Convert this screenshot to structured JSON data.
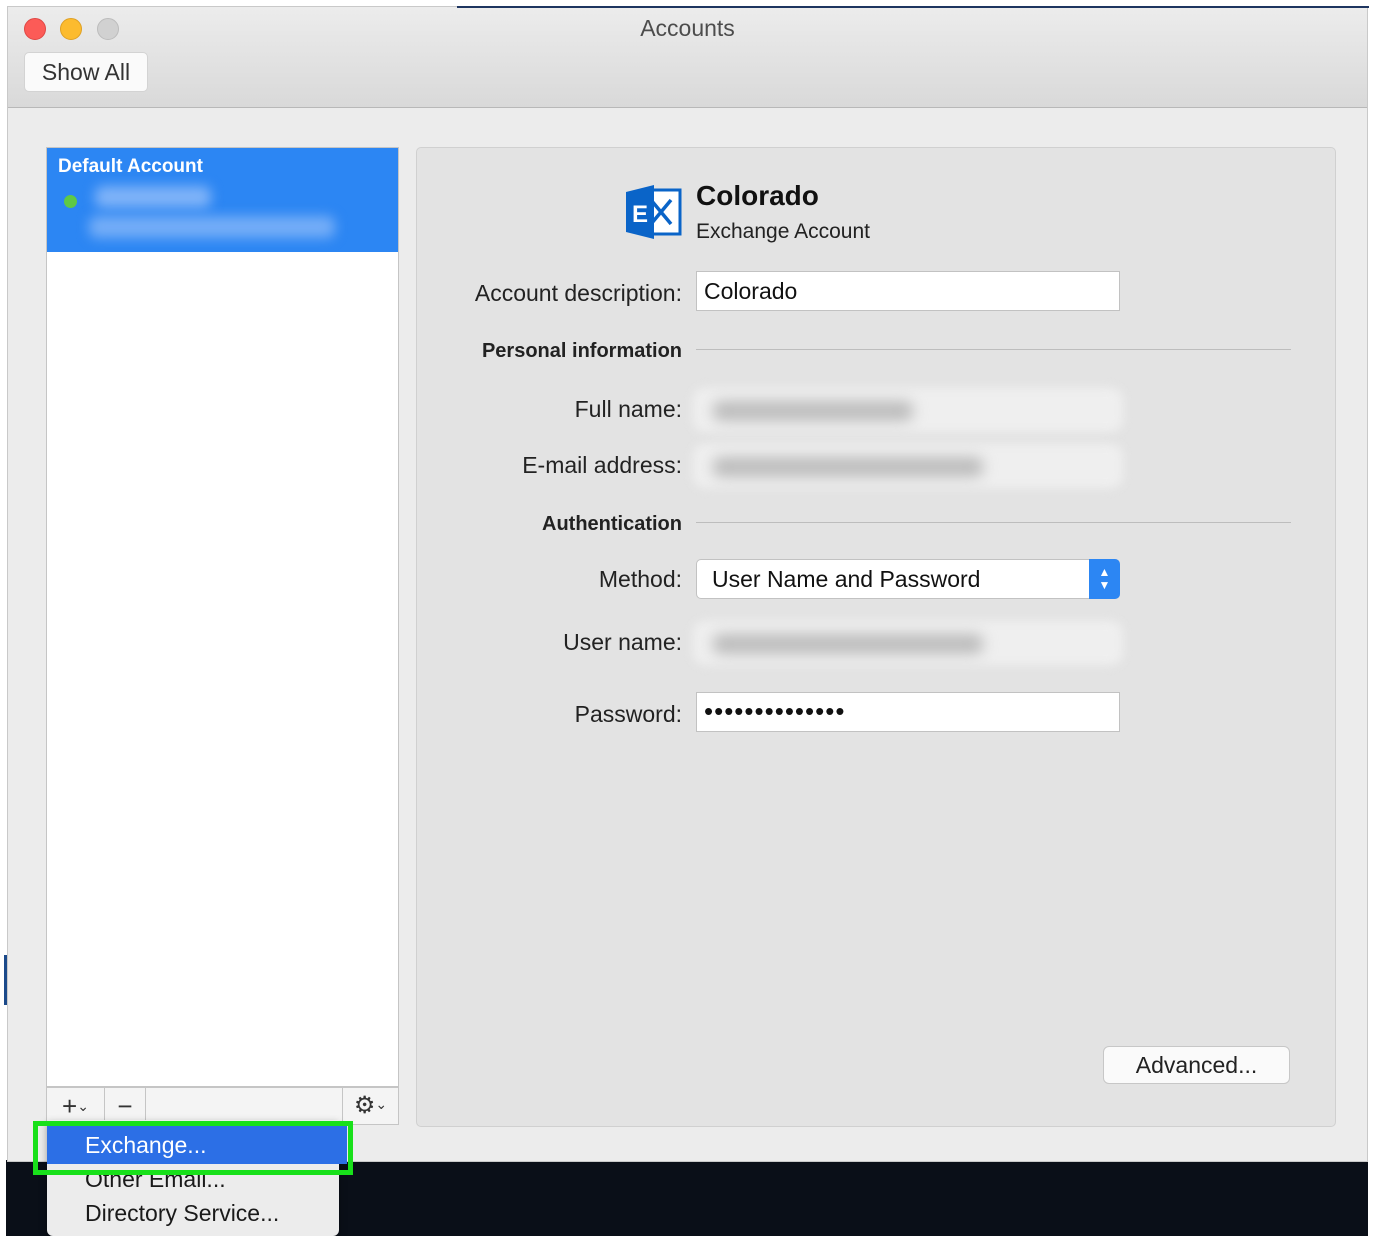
{
  "window": {
    "title": "Accounts",
    "show_all_label": "Show All"
  },
  "sidebar": {
    "selected_account_header": "Default Account",
    "status_color": "#5ec946"
  },
  "toolbar": {
    "add_symbol": "+",
    "remove_symbol": "−",
    "chevron": "⌄",
    "gear_symbol": "⚙"
  },
  "account": {
    "name": "Colorado",
    "type": "Exchange Account",
    "logo_letter": "E",
    "description_label": "Account description:",
    "description_value": "Colorado",
    "personal_section": "Personal information",
    "full_name_label": "Full name:",
    "email_label": "E-mail address:",
    "auth_section": "Authentication",
    "method_label": "Method:",
    "method_value": "User Name and Password",
    "username_label": "User name:",
    "password_label": "Password:",
    "password_value": "••••••••••••••",
    "advanced_label": "Advanced..."
  },
  "add_menu": {
    "items": [
      "Exchange...",
      "Other Email...",
      "Directory Service..."
    ],
    "highlight_color": "#18e01a"
  },
  "colors": {
    "accent": "#2c86f3",
    "menu_selection": "#2c6fe6",
    "exchange_blue": "#0a64c8"
  }
}
